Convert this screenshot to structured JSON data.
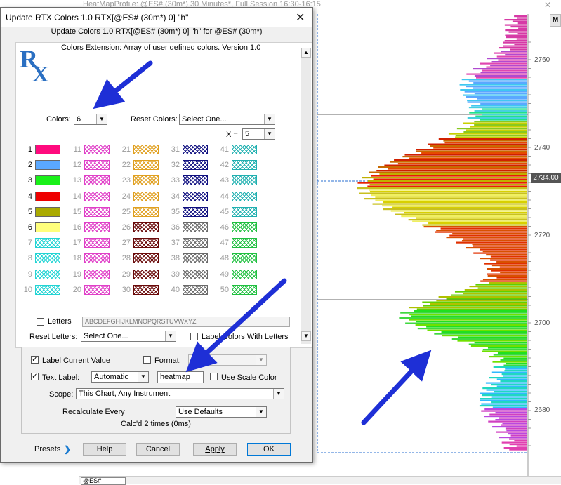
{
  "chart_window": {
    "title": "HeatMapProfile: @ES# (30m*) 30 Minutes*, Full Session 16:30-16:15",
    "m_button": "M",
    "current_price": "2734.00",
    "price_labels": [
      "2760",
      "2740",
      "2720",
      "2700",
      "2680"
    ],
    "symbol": "@ES#"
  },
  "dialog": {
    "title": "Update RTX Colors 1.0 RTX[@ES# (30m*) 0] \"h\"",
    "subtitle": "Update Colors 1.0 RTX[@ES# (30m*) 0] \"h\" for @ES# (30m*)",
    "description": "Colors Extension: Array of user defined colors. Version 1.0",
    "colors_label": "Colors:",
    "colors_value": "6",
    "reset_colors_label": "Reset Colors:",
    "reset_colors_value": "Select One...",
    "x_label": "X =",
    "x_value": "5",
    "color_numbers": [
      "1",
      "2",
      "3",
      "4",
      "5",
      "6",
      "7",
      "8",
      "9",
      "10",
      "11",
      "12",
      "13",
      "14",
      "15",
      "16",
      "17",
      "18",
      "19",
      "20",
      "21",
      "22",
      "23",
      "24",
      "25",
      "26",
      "27",
      "28",
      "29",
      "30",
      "31",
      "32",
      "33",
      "34",
      "35",
      "36",
      "37",
      "38",
      "39",
      "40",
      "41",
      "42",
      "43",
      "44",
      "45",
      "46",
      "47",
      "48",
      "49",
      "50"
    ],
    "active_colors": [
      "#ff0a7e",
      "#5aa8ff",
      "#19f019",
      "#ee0000",
      "#aaaa00",
      "#ffff7c"
    ],
    "letters_label": "Letters",
    "letters_value": "ABCDEFGHIJKLMNOPQRSTUVWXYZ",
    "reset_letters_label": "Reset Letters:",
    "reset_letters_value": "Select One...",
    "label_colors_letters": "Label Colors With Letters",
    "label_current_value": "Label Current Value",
    "format_label": "Format:",
    "text_label": "Text Label:",
    "text_label_mode": "Automatic",
    "text_label_value": "heatmap",
    "use_scale_color": "Use Scale Color",
    "scope_label": "Scope:",
    "scope_value": "This Chart, Any Instrument",
    "recalculate_label": "Recalculate Every",
    "recalculate_value": "Use Defaults",
    "calc_text": "Calc'd 2 times (0ms)",
    "presets_label": "Presets",
    "help_button": "Help",
    "cancel_button": "Cancel",
    "apply_button": "Apply",
    "ok_button": "OK"
  }
}
